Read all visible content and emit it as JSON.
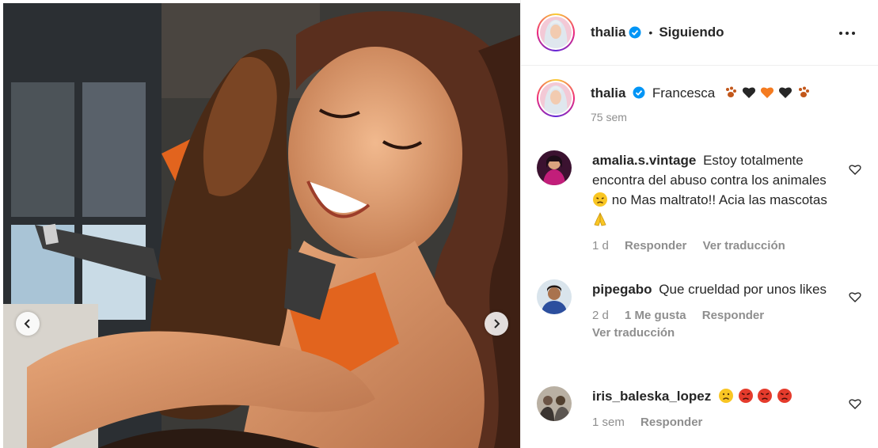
{
  "post": {
    "author": "thalia",
    "follow_status": "Siguiendo",
    "separator": "•"
  },
  "caption": {
    "username": "thalia",
    "text": "Francesca",
    "emojis": [
      "paw-prints-icon",
      "black-heart-icon",
      "orange-heart-icon",
      "black-heart-icon",
      "paw-prints-icon"
    ],
    "time": "75 sem"
  },
  "comments": [
    {
      "username": "amalia.s.vintage",
      "text_part1": "Estoy totalmente encontra del abuso contra los animales",
      "text_part2": "no Mas maltrato!! Acia las mascotas",
      "emojis": [
        "disappointed-face-icon",
        "folded-hands-icon"
      ],
      "time": "1 d",
      "likes": "",
      "reply_label": "Responder",
      "translate_label": "Ver traducción"
    },
    {
      "username": "pipegabo",
      "text": "Que crueldad por unos likes",
      "time": "2 d",
      "likes": "1 Me gusta",
      "reply_label": "Responder",
      "translate_label": "Ver traducción"
    },
    {
      "username": "iris_baleska_lopez",
      "text": "",
      "emojis": [
        "sad-face-icon",
        "angry-face-icon",
        "angry-face-icon",
        "angry-face-icon"
      ],
      "time": "1 sem",
      "reply_label": "Responder"
    }
  ],
  "colors": {
    "text": "#262626",
    "secondary": "#8e8e8e",
    "verified": "#0095f6",
    "border": "#efefef"
  }
}
